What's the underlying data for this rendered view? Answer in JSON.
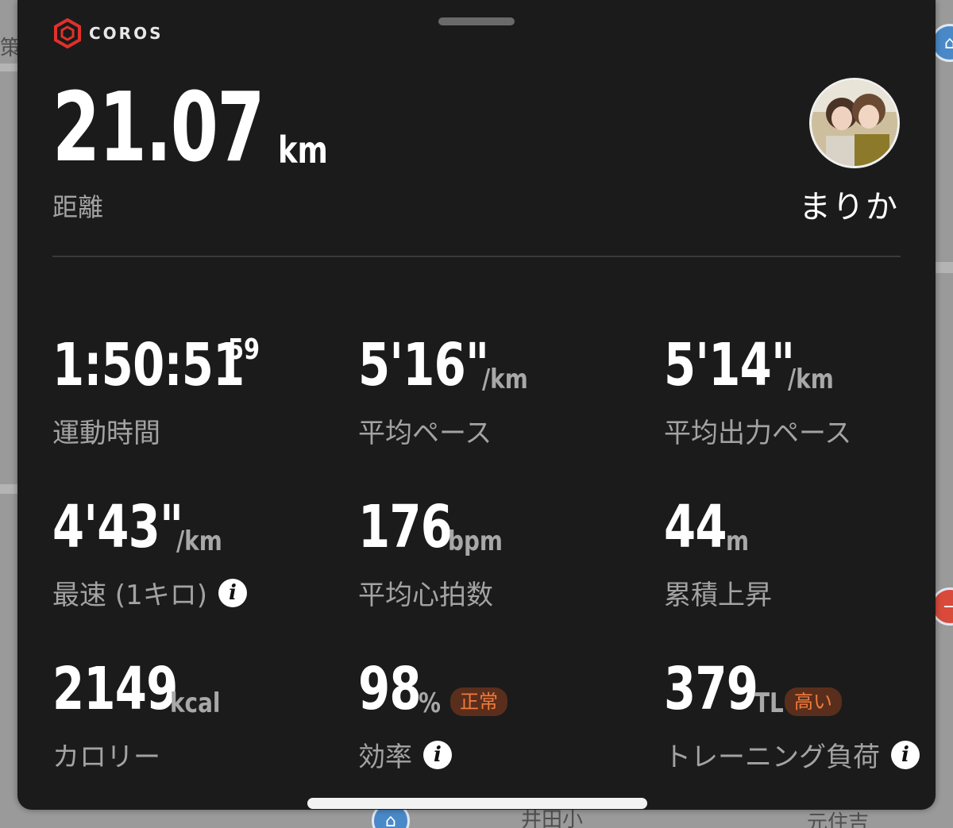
{
  "brand": {
    "name": "COROS",
    "accent": "#e0312a"
  },
  "headline": {
    "value": "21.07",
    "unit": "km",
    "label": "距離"
  },
  "user": {
    "name": "まりか"
  },
  "metrics": [
    {
      "value": "1:50:51",
      "sup": "59",
      "label": "運動時間"
    },
    {
      "value": "5'16\"",
      "unit": "/km",
      "label": "平均ペース"
    },
    {
      "value": "5'14\"",
      "unit": "/km",
      "label": "平均出力ペース"
    },
    {
      "value": "4'43\"",
      "unit": "/km",
      "label": "最速 (1キロ)"
    },
    {
      "value": "176",
      "unit": "bpm",
      "label": "平均心拍数"
    },
    {
      "value": "44",
      "unit": "m",
      "label": "累積上昇"
    },
    {
      "value": "2149",
      "unit": "kcal",
      "label": "カロリー"
    },
    {
      "value": "98",
      "unit": "%",
      "badge": "正常",
      "label": "効率"
    },
    {
      "value": "379",
      "unit": "TL",
      "badge": "高い",
      "label": "トレーニング負荷"
    }
  ],
  "map_labels": {
    "left_top": "策",
    "bottom_center": "井田小",
    "bottom_right": "元住吉"
  },
  "colors": {
    "card_bg": "#1b1b1b",
    "badge_bg": "#5a2e1c",
    "badge_text": "#f07a3c"
  }
}
